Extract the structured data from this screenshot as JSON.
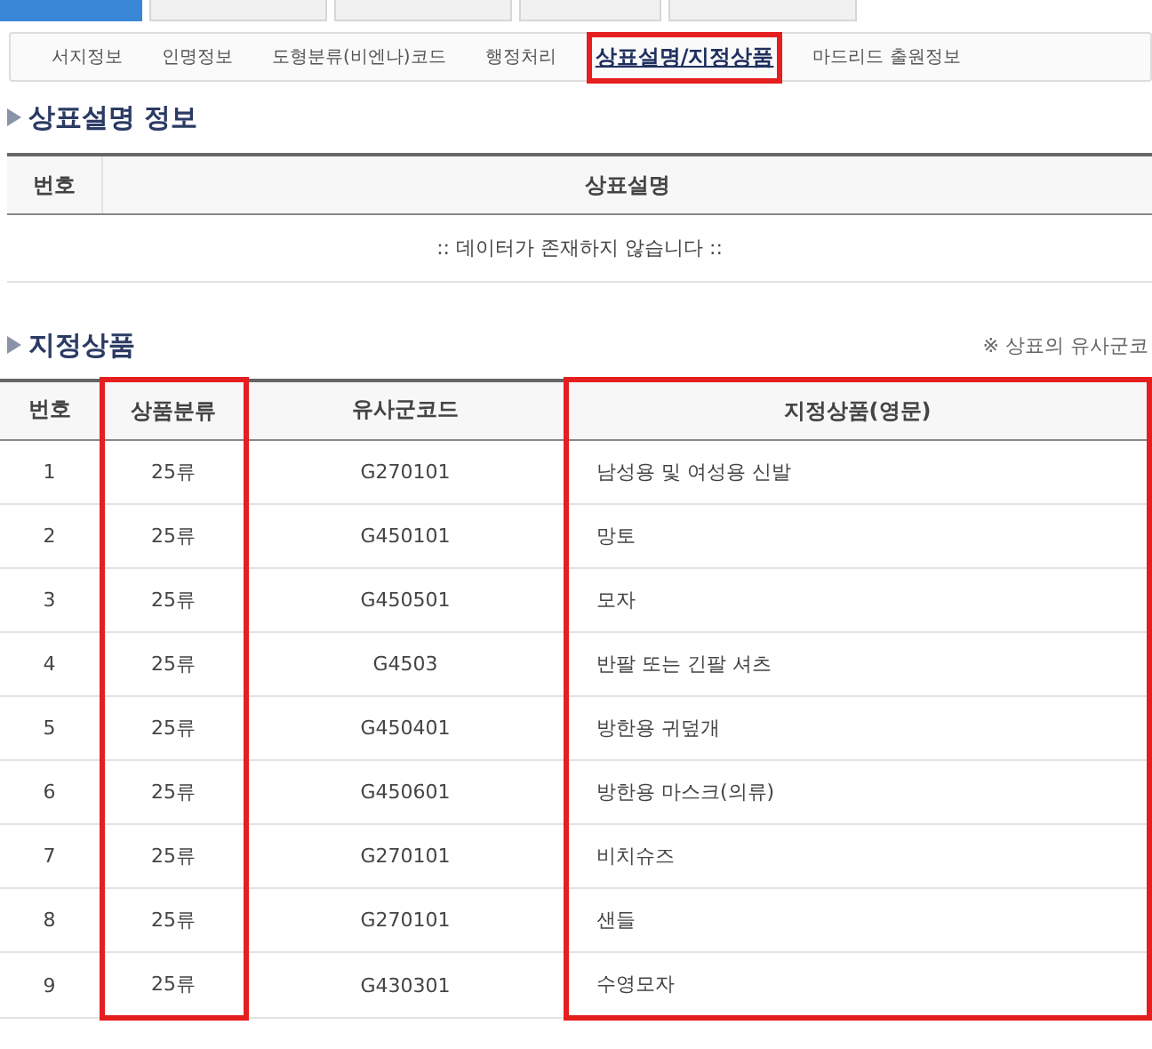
{
  "top_tabs": [
    {
      "selected": true
    },
    {
      "selected": false
    },
    {
      "selected": false
    },
    {
      "selected": false
    },
    {
      "selected": false
    }
  ],
  "sub_nav": [
    {
      "label": "서지정보",
      "selected": false,
      "highlighted": false
    },
    {
      "label": "인명정보",
      "selected": false,
      "highlighted": false
    },
    {
      "label": "도형분류(비엔나)코드",
      "selected": false,
      "highlighted": false
    },
    {
      "label": "행정처리",
      "selected": false,
      "highlighted": false
    },
    {
      "label": "상표설명/지정상품",
      "selected": true,
      "highlighted": true
    },
    {
      "label": "마드리드 출원정보",
      "selected": false,
      "highlighted": false
    }
  ],
  "description_section": {
    "title": "상표설명 정보",
    "columns": [
      {
        "label": "번호",
        "highlighted": false
      },
      {
        "label": "상표설명",
        "highlighted": false
      }
    ],
    "empty_message": ":: 데이터가 존재하지 않습니다 ::"
  },
  "goods_section": {
    "title": "지정상품",
    "note": "※ 상표의 유사군코",
    "columns": [
      {
        "label": "번호",
        "highlighted": false
      },
      {
        "label": "상품분류",
        "highlighted": true
      },
      {
        "label": "유사군코드",
        "highlighted": false
      },
      {
        "label": "지정상품(영문)",
        "highlighted": true
      }
    ],
    "rows": [
      [
        "1",
        "25류",
        "G270101",
        "남성용 및 여성용 신발"
      ],
      [
        "2",
        "25류",
        "G450101",
        "망토"
      ],
      [
        "3",
        "25류",
        "G450501",
        "모자"
      ],
      [
        "4",
        "25류",
        "G4503",
        "반팔 또는 긴팔 셔츠"
      ],
      [
        "5",
        "25류",
        "G450401",
        "방한용 귀덮개"
      ],
      [
        "6",
        "25류",
        "G450601",
        "방한용 마스크(의류)"
      ],
      [
        "7",
        "25류",
        "G270101",
        "비치슈즈"
      ],
      [
        "8",
        "25류",
        "G270101",
        "샌들"
      ],
      [
        "9",
        "25류",
        "G430301",
        "수영모자"
      ]
    ]
  }
}
